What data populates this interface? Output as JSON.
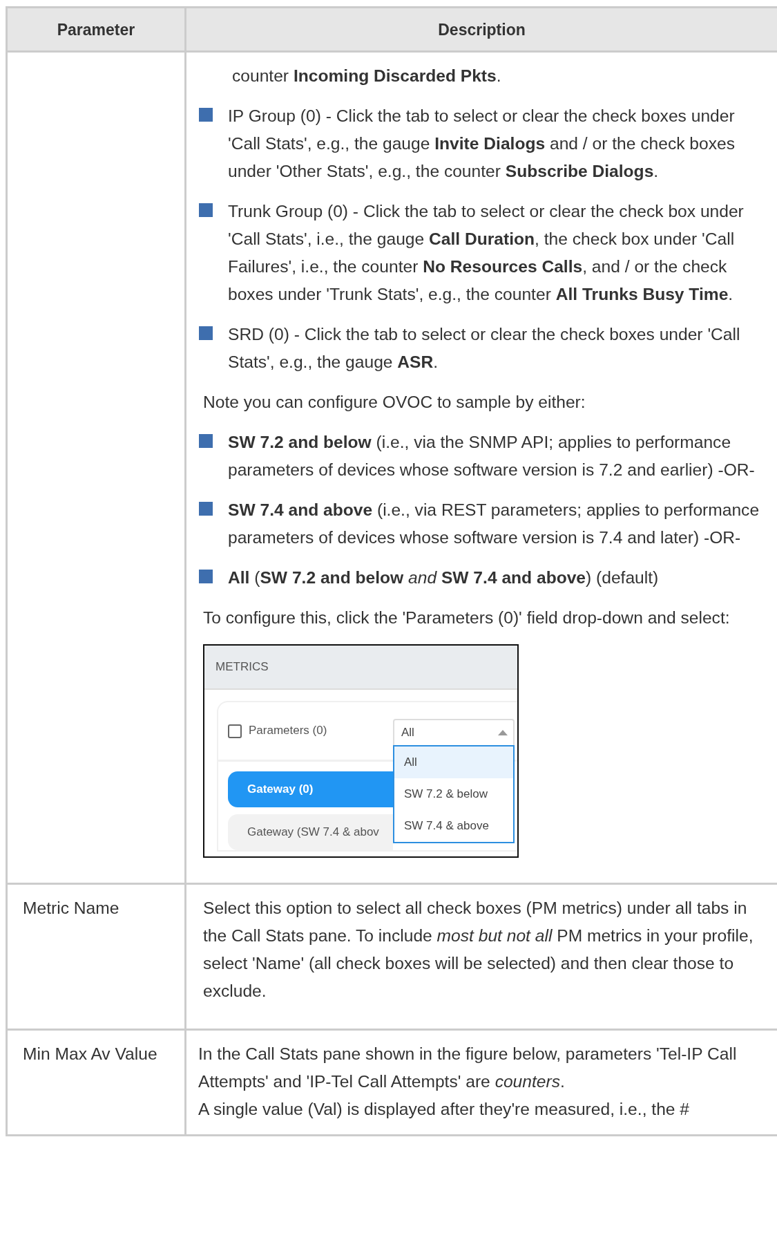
{
  "table": {
    "columns": [
      "Parameter",
      "Description"
    ],
    "rows": [
      {
        "description": [
          {
            "kind": "continuation",
            "text": "counter **Incoming Discarded Pkts**."
          },
          {
            "kind": "bullet",
            "text": "IP Group (0) - Click the tab to select or clear the check boxes under 'Call Stats', e.g., the gauge **Invite Dialogs** and / or the check boxes under 'Other Stats', e.g., the counter **Subscribe Dialogs**."
          },
          {
            "kind": "bullet",
            "text": "Trunk Group (0) - Click the tab to select or clear the check box under 'Call Stats', i.e., the gauge **Call Duration**, the check box under 'Call Failures', i.e., the counter **No Resources Calls**, and / or the check boxes under 'Trunk Stats', e.g., the counter **All Trunks Busy Time**."
          },
          {
            "kind": "bullet",
            "text": "SRD (0) - Click the tab to select or clear the check boxes under 'Call Stats', e.g., the gauge **ASR**."
          },
          {
            "kind": "paragraph",
            "text": "Note you can configure OVOC to sample by either:"
          },
          {
            "kind": "bullet",
            "text": "**SW 7.2 and below** (i.e., via the SNMP API; applies to performance parameters of devices whose software version is 7.2 and earlier) -OR-"
          },
          {
            "kind": "bullet",
            "text": "**SW 7.4 and above** (i.e., via REST parameters; applies to performance parameters of devices whose software version is 7.4 and later) -OR-"
          },
          {
            "kind": "bullet",
            "text": "**All** (**SW 7.2 and below** *and* **SW 7.4 and above**) (default)"
          },
          {
            "kind": "paragraph",
            "text": "To configure this, click the 'Parameters (0)' field drop-down and select:"
          },
          {
            "kind": "figure",
            "header": "METRICS",
            "checkbox": {
              "label": "Parameters (0)",
              "checked": false
            },
            "dropdown": {
              "value": "All",
              "options": [
                {
                  "label": "All",
                  "selected": true
                },
                {
                  "label": "SW 7.2 & below",
                  "selected": false
                },
                {
                  "label": "SW 7.4 & above",
                  "selected": false
                }
              ]
            },
            "tabs": [
              {
                "label": "Gateway (0)",
                "selected": true
              },
              {
                "label": "Gateway (SW 7.4 & abov",
                "selected": false
              }
            ]
          }
        ]
      },
      {
        "parameter": "Metric Name",
        "description": [
          {
            "kind": "paragraph",
            "text": "Select this option to select all check boxes (PM metrics) under all tabs in the Call Stats pane. To include *most but not all* PM metrics in your profile, select 'Name' (all check boxes will be selected) and then clear those to exclude."
          }
        ]
      },
      {
        "parameter": "Min Max Av Value",
        "description": [
          {
            "kind": "line",
            "text": "In the Call Stats pane shown in the figure below, parameters 'Tel-IP Call Attempts' and 'IP-Tel Call Attempts' are *counters*."
          },
          {
            "kind": "line",
            "text": "A single value (Val) is displayed after they're measured, i.e., the #"
          }
        ]
      }
    ]
  }
}
